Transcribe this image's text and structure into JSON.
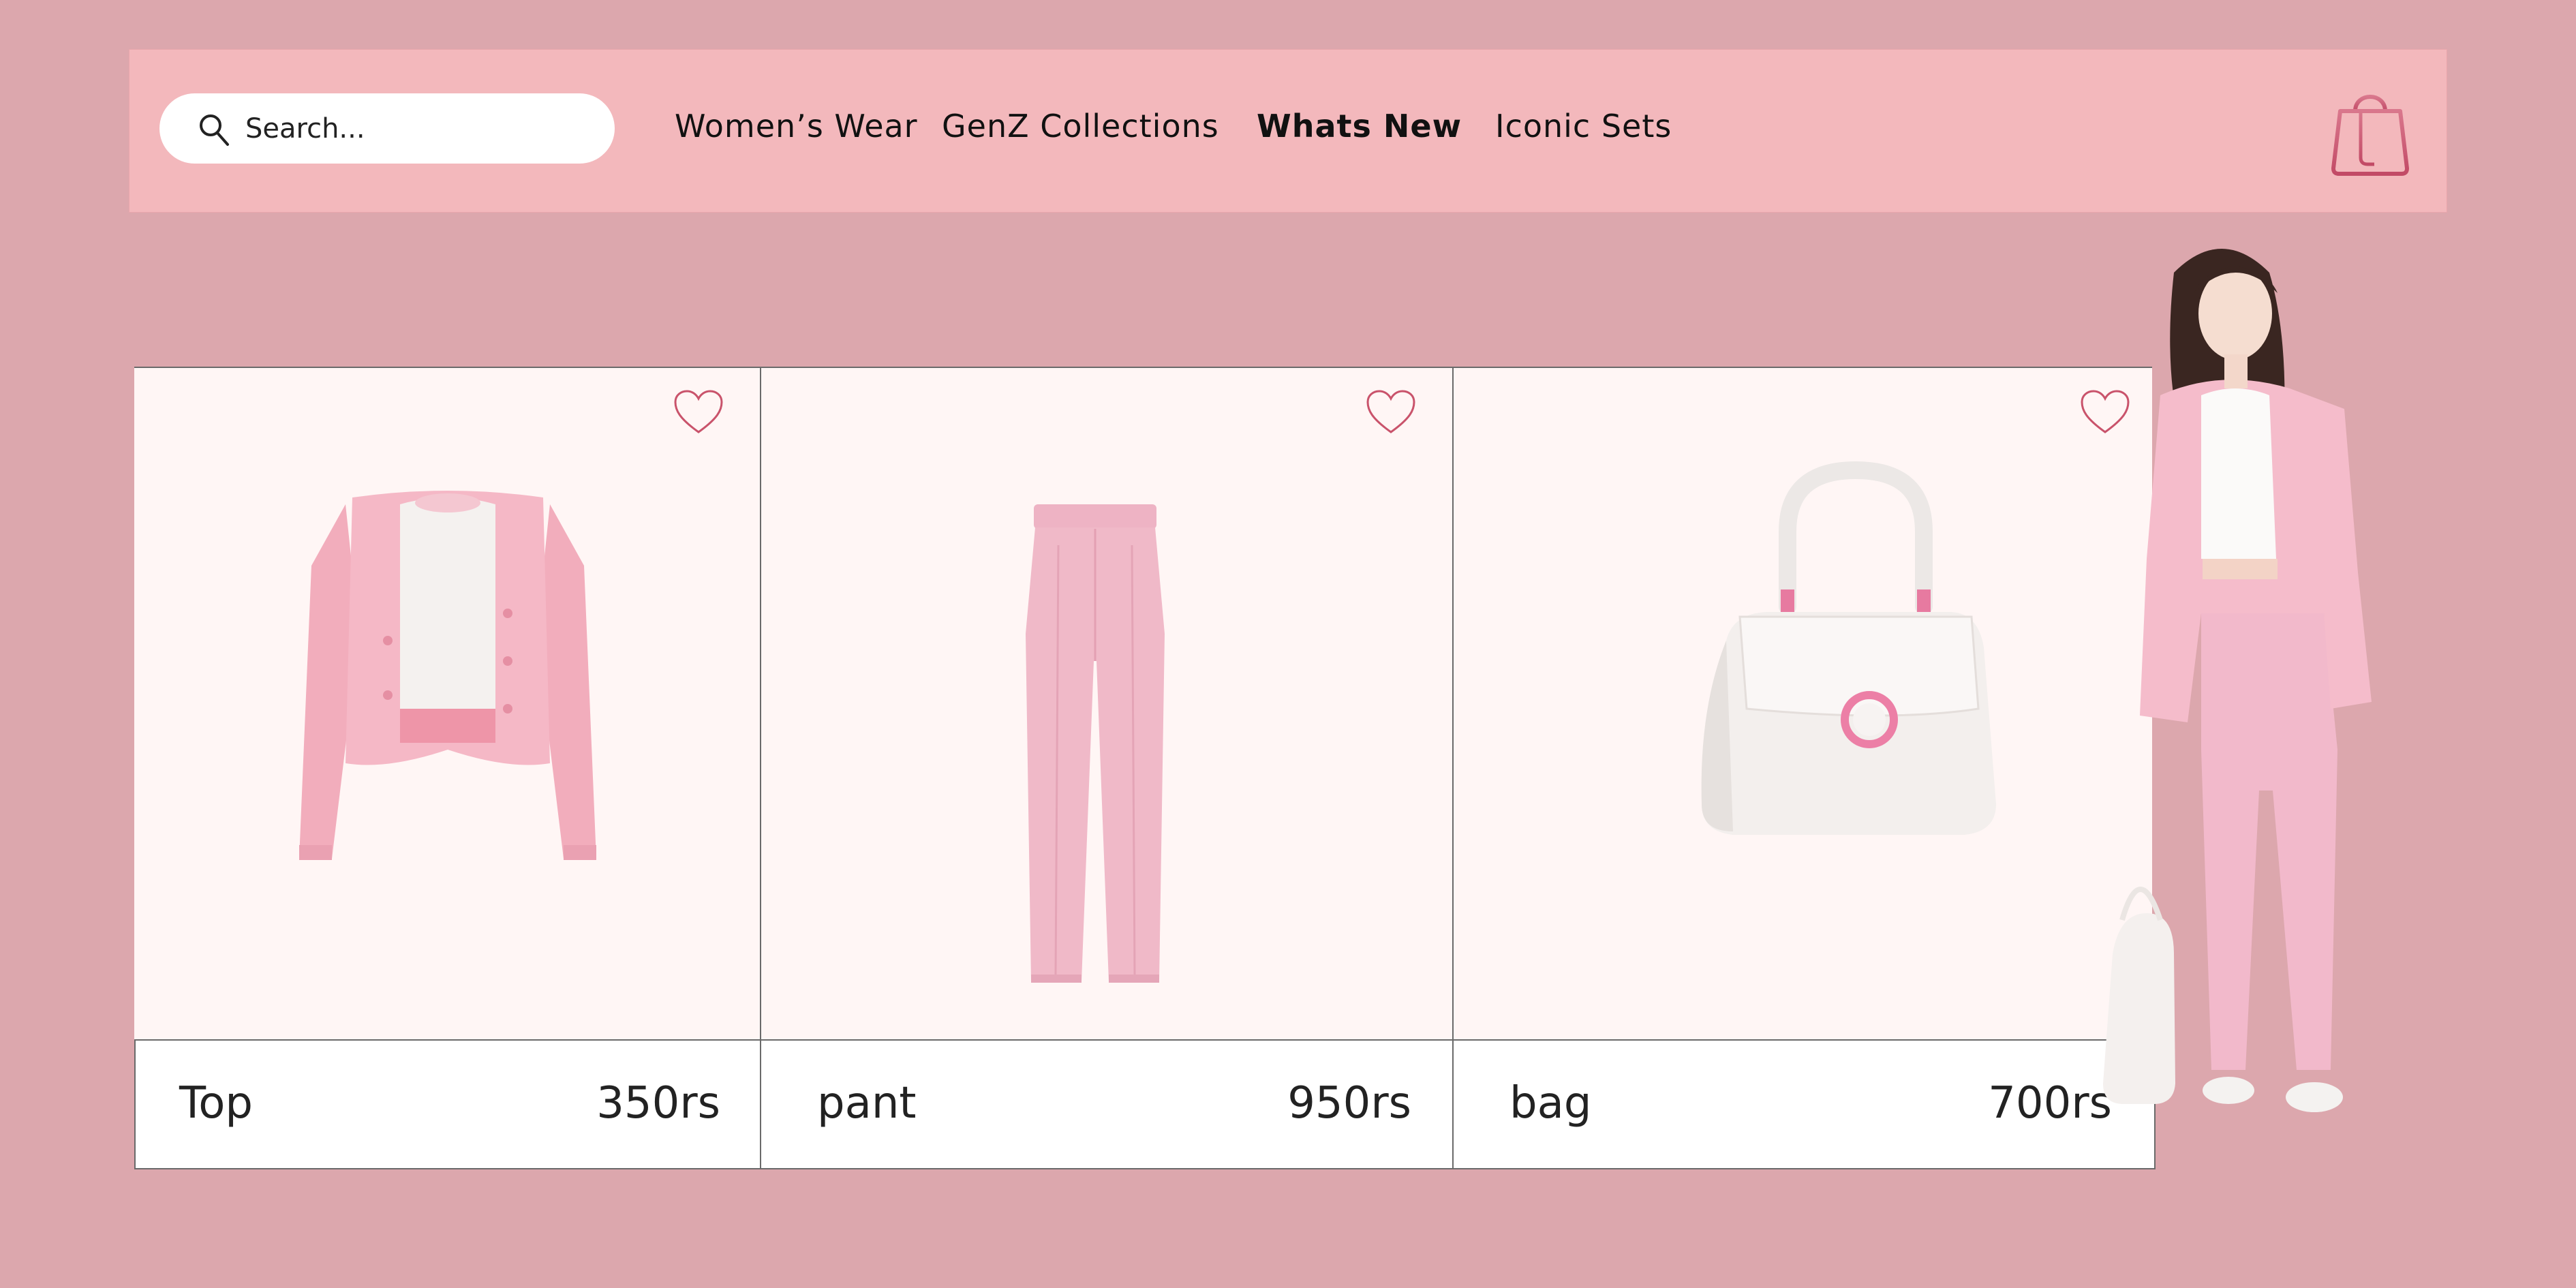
{
  "search": {
    "placeholder": "Search..."
  },
  "nav": {
    "items": [
      {
        "label": "Women’s Wear",
        "active": false
      },
      {
        "label": "GenZ Collections",
        "active": false
      },
      {
        "label": "Whats New",
        "active": true
      },
      {
        "label": "Iconic Sets",
        "active": false
      }
    ]
  },
  "icons": {
    "search": "search-icon",
    "cart": "shopping-bag-icon",
    "favorite": "heart-icon"
  },
  "products": [
    {
      "name": "Top",
      "price": "350rs",
      "image": "pink-cardigan-with-white-top"
    },
    {
      "name": "pant",
      "price": "950rs",
      "image": "pink-trousers"
    },
    {
      "name": "bag",
      "price": "700rs",
      "image": "white-handbag-pink-ring"
    }
  ],
  "colors": {
    "page_background": "#dca7ad",
    "header_background": "#f3b8bc",
    "card_background": "#fff6f5",
    "accent": "#c9536b"
  }
}
